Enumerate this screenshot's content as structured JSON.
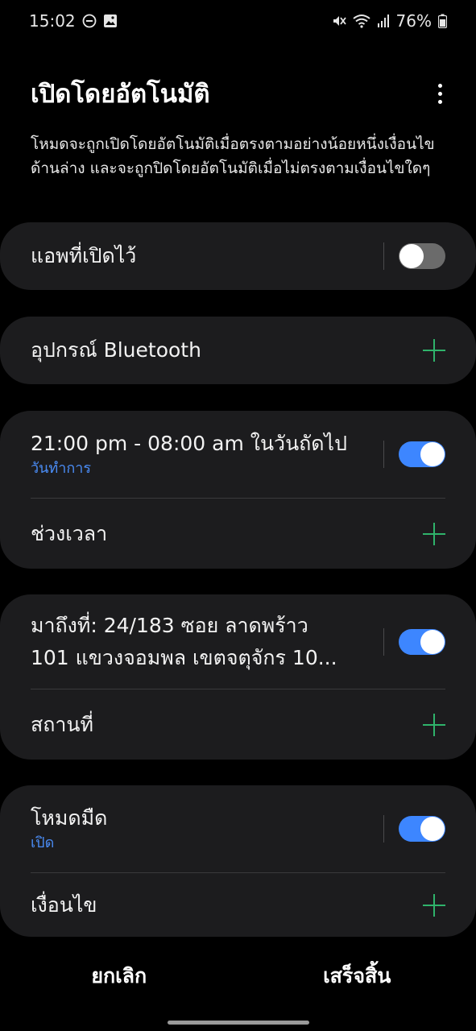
{
  "status_bar": {
    "time": "15:02",
    "battery": "76%",
    "icons_left": [
      "do-not-disturb-icon",
      "gallery-icon"
    ],
    "icons_right": [
      "mute-icon",
      "wifi-icon",
      "signal-icon",
      "battery-icon"
    ]
  },
  "header": {
    "title": "เปิดโดยอัตโนมัติ",
    "more_icon": "more-vertical-icon"
  },
  "description": "โหมดจะถูกเปิดโดยอัตโนมัติเมื่อตรงตามอย่างน้อยหนึ่งเงื่อนไขด้านล่าง และจะถูกปิดโดยอัตโนมัติเมื่อไม่ตรงตามเงื่อนไขใดๆ",
  "cards": {
    "apps": {
      "label": "แอพที่เปิดไว้",
      "toggle_on": false
    },
    "bluetooth": {
      "label": "อุปกรณ์ Bluetooth",
      "action_icon": "plus-icon"
    },
    "schedule": {
      "title": "21:00 pm - 08:00 am ในวันถัดไป",
      "subtitle": "วันทำการ",
      "toggle_on": true,
      "add_label": "ช่วงเวลา"
    },
    "location": {
      "title_line1": "มาถึงที่: 24/183 ซอย ลาดพร้าว",
      "title_line2": "101 แขวงจอมพล เขตจตุจักร  10...",
      "toggle_on": true,
      "add_label": "สถานที่"
    },
    "dark_mode": {
      "title": "โหมดมืด",
      "subtitle": "เปิด",
      "toggle_on": true,
      "add_label": "เงื่อนไข"
    }
  },
  "bottom": {
    "cancel": "ยกเลิก",
    "done": "เสร็จสิ้น"
  },
  "colors": {
    "background": "#000000",
    "card": "#1c1c1e",
    "accent_blue": "#3d86ff",
    "subtitle_blue": "#4a8cf5",
    "plus_green": "#2fb36b"
  }
}
